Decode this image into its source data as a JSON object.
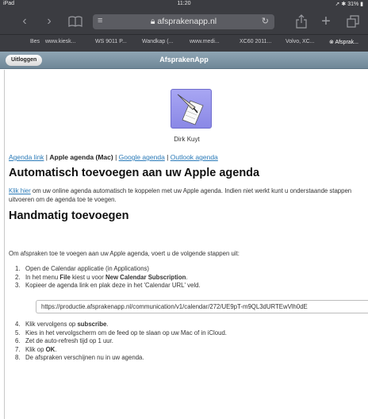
{
  "status": {
    "device": "iPad",
    "time": "11:20",
    "battery": "31%"
  },
  "browser": {
    "url_host": "afsprakenapp.nl",
    "bookmarks": [
      "Bes",
      "www.kiesk...",
      "WS 9011 P...",
      "Wandkap (...",
      "www.medi...",
      "XC60 2011...",
      "Volvo, XC...",
      "Afsprak..."
    ]
  },
  "app": {
    "logout_label": "Uitloggen",
    "title": "AfsprakenApp"
  },
  "profile": {
    "name": "Dirk Kuyt"
  },
  "links": {
    "agenda_link": "Agenda link",
    "sep": "|",
    "apple": "Apple agenda (Mac)",
    "google": "Google agenda",
    "outlook": "Outlook agenda"
  },
  "auto": {
    "heading": "Automatisch toevoegen aan uw Apple agenda",
    "click_here": "Klik hier",
    "text": " om uw online agenda automatisch te koppelen met uw Apple agenda. Indien niet werkt kunt u onderstaande stappen uitvoeren om de agenda toe te voegen."
  },
  "manual": {
    "heading": "Handmatig toevoegen",
    "intro": "Om afspraken toe te voegen aan uw Apple agenda, voert u de volgende stappen uit:",
    "steps_a": [
      {
        "n": "1.",
        "pre": "Open de Calendar applicatie (in Applications)",
        "bold": "",
        "post": ""
      },
      {
        "n": "2.",
        "pre": "In het menu ",
        "bold": "File",
        "post": " kiest u voor "
      },
      {
        "n": "3.",
        "pre": "Kopieer de agenda link en plak deze in het 'Calendar URL' veld.",
        "bold": "",
        "post": ""
      }
    ],
    "step2_bold2": "New Calendar Subscription",
    "step2_end": ".",
    "calendar_url": "https://productie.afsprakenapp.nl/communication/v1/calendar/272/UE9pT-m9QL3dURTEwVlh0dE",
    "steps_b": [
      {
        "n": "4.",
        "pre": "Klik vervolgens op ",
        "bold": "subscribe",
        "post": "."
      },
      {
        "n": "5.",
        "pre": "Kies in het vervolgscherm om de feed op te slaan op uw Mac of in iCloud.",
        "bold": "",
        "post": ""
      },
      {
        "n": "6.",
        "pre": "Zet de auto-refresh tijd op 1 uur.",
        "bold": "",
        "post": ""
      },
      {
        "n": "7.",
        "pre": "Klik op ",
        "bold": "OK",
        "post": "."
      },
      {
        "n": "8.",
        "pre": "De afspraken verschijnen nu in uw agenda.",
        "bold": "",
        "post": ""
      }
    ]
  }
}
